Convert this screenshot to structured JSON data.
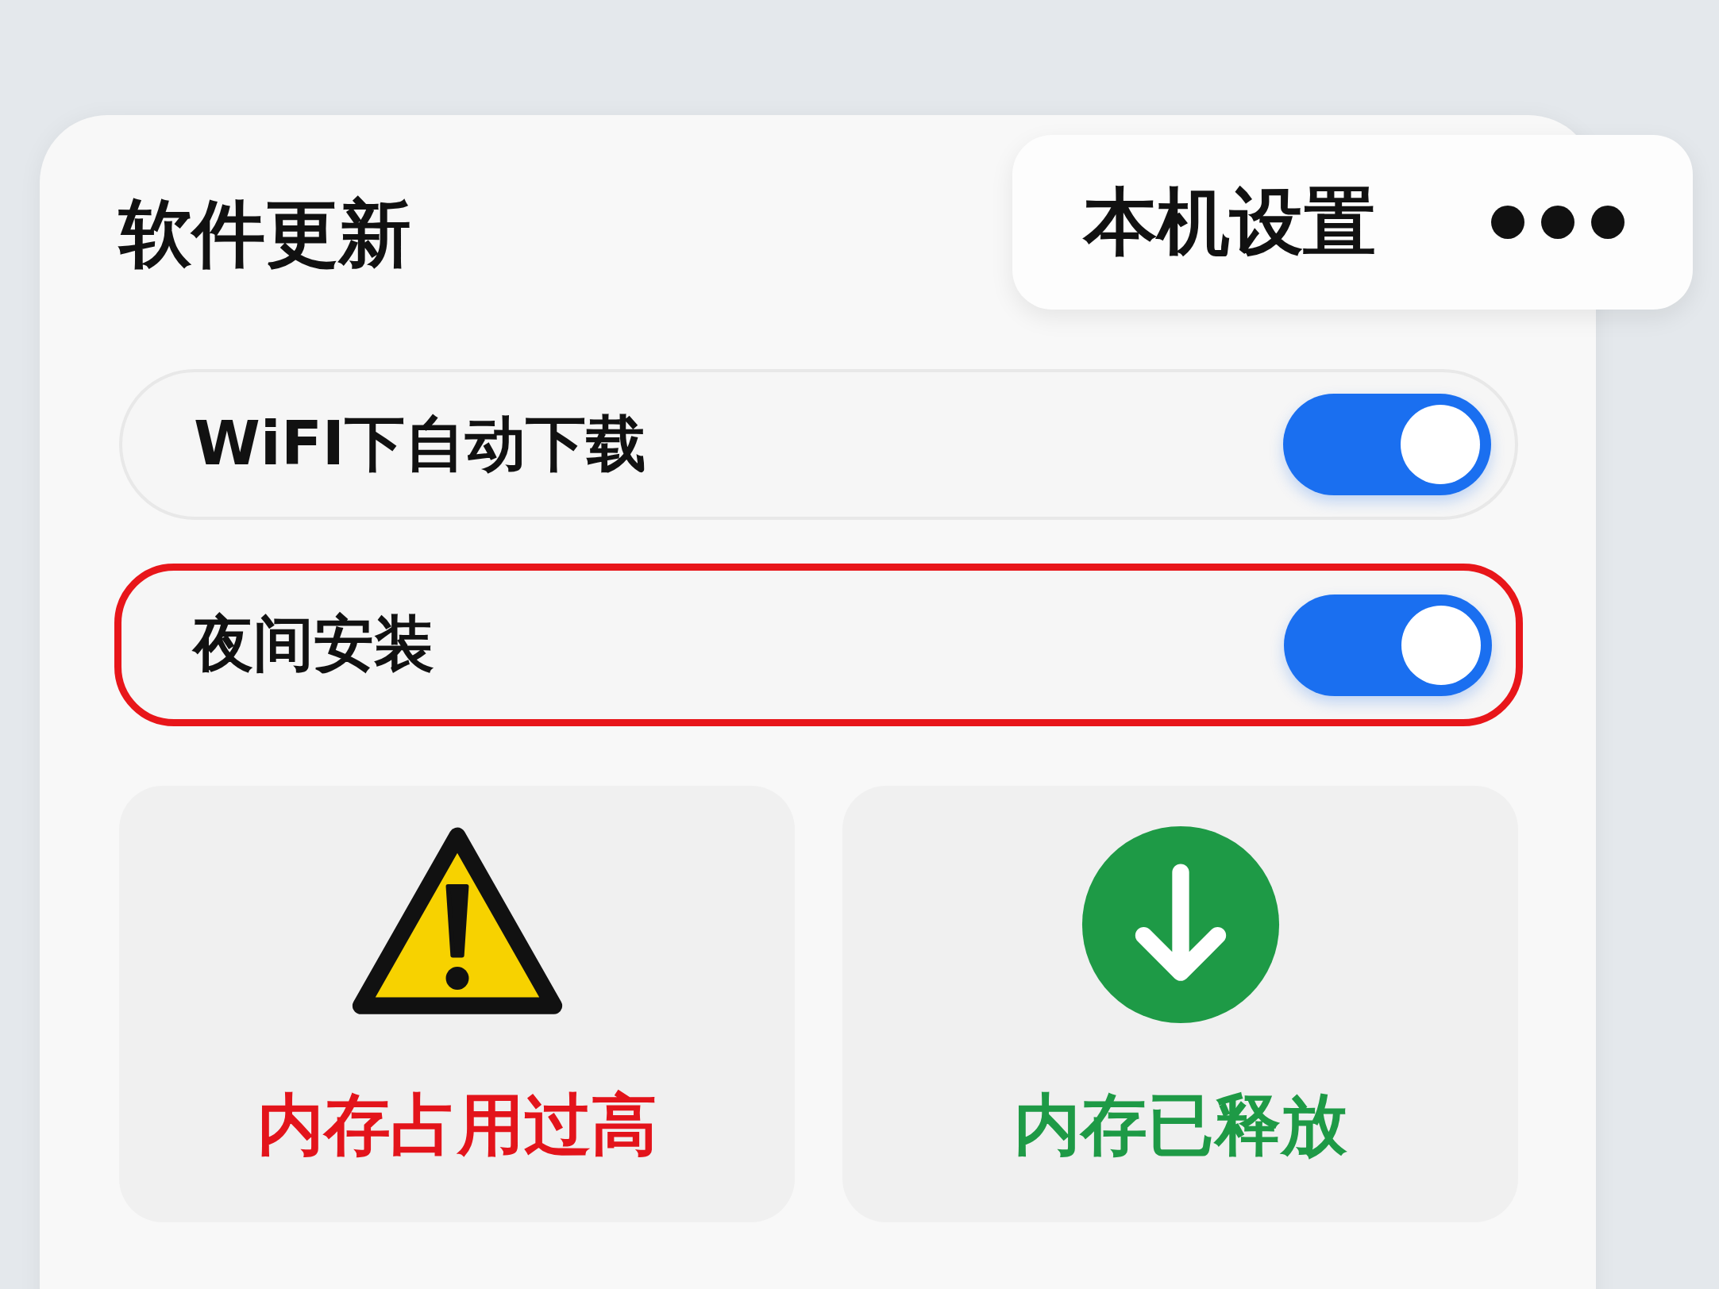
{
  "title": "软件更新",
  "overlay": {
    "title": "本机设置"
  },
  "settings": [
    {
      "label": "WiFI下自动下载",
      "on": true,
      "highlighted": false
    },
    {
      "label": "夜间安装",
      "on": true,
      "highlighted": true
    }
  ],
  "tiles": [
    {
      "kind": "warning",
      "label": "内存占用过高",
      "color": "#e3141b"
    },
    {
      "kind": "released",
      "label": "内存已释放",
      "color": "#1e9a46"
    }
  ]
}
